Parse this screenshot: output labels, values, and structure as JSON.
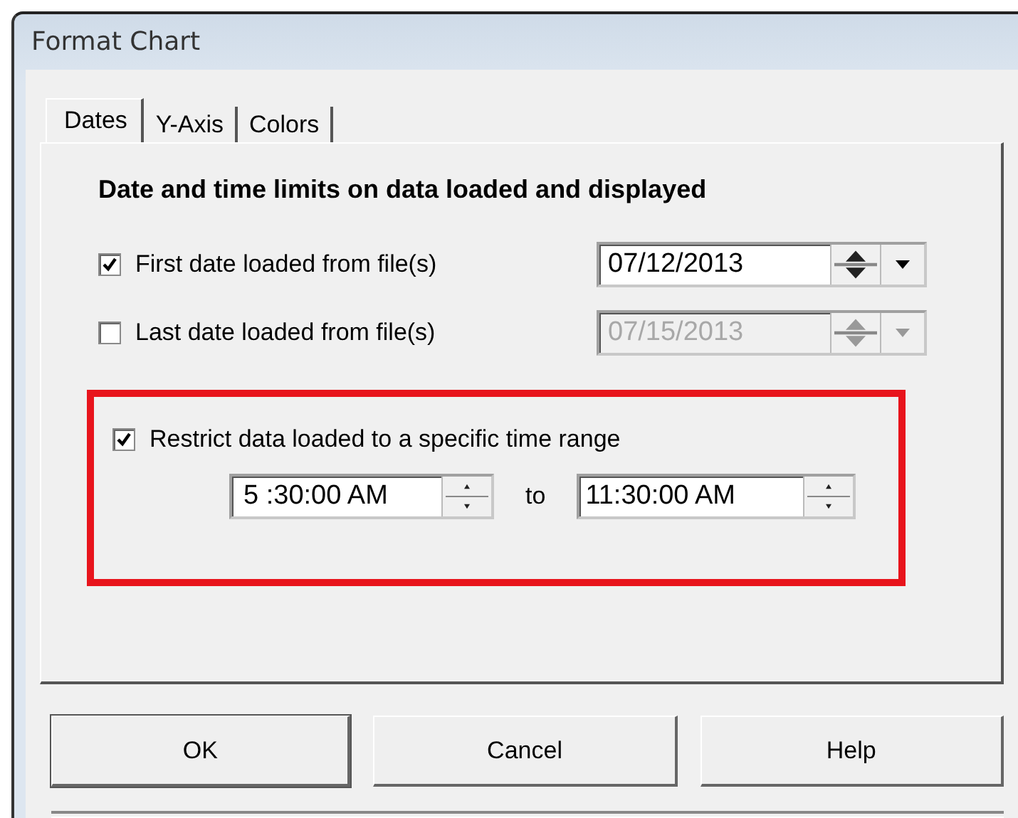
{
  "window": {
    "title": "Format Chart"
  },
  "tabs": [
    {
      "label": "Dates",
      "selected": true
    },
    {
      "label": "Y-Axis",
      "selected": false
    },
    {
      "label": "Colors",
      "selected": false
    }
  ],
  "heading": "Date and time limits on data loaded and displayed",
  "date_limits": [
    {
      "label": "First date loaded from file(s)",
      "checked": true,
      "disabled": false,
      "value": "07/12/2013"
    },
    {
      "label": "Last date loaded from file(s)",
      "checked": false,
      "disabled": true,
      "value": "07/15/2013"
    }
  ],
  "time_range": {
    "label": "Restrict data loaded to a specific time range",
    "checked": true,
    "highlighted": true,
    "start": "5 :30:00 AM",
    "separator": "to",
    "end": "11:30:00 AM"
  },
  "buttons": [
    {
      "label": "OK",
      "default": true
    },
    {
      "label": "Cancel",
      "default": false
    },
    {
      "label": "Help",
      "default": false
    }
  ]
}
